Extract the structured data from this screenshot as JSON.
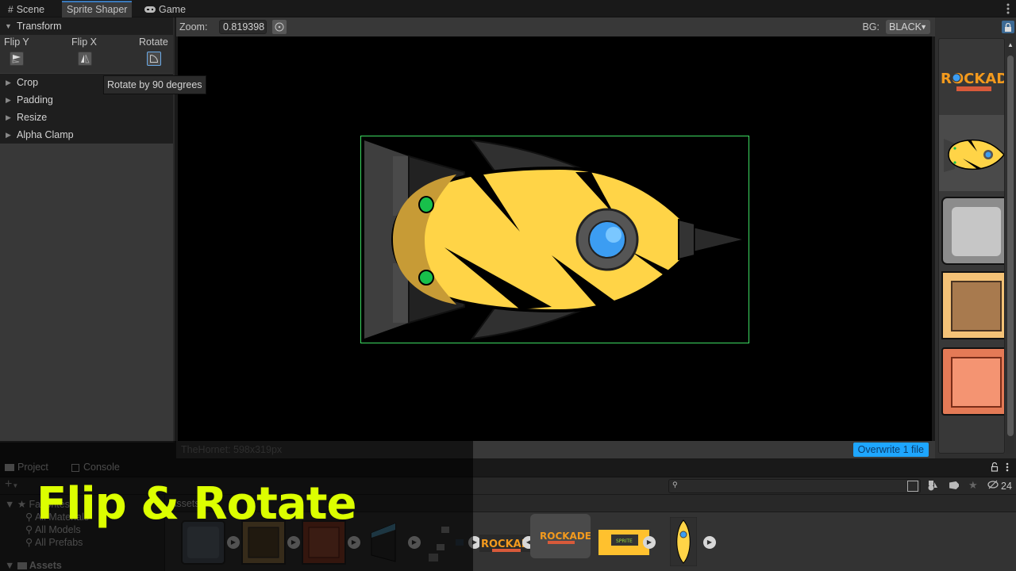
{
  "window": {
    "tabs": [
      {
        "label": "Scene",
        "icon": "grid-icon",
        "active": false
      },
      {
        "label": "Sprite Shaper",
        "active": true
      },
      {
        "label": "Game",
        "icon": "gamepad-icon",
        "active": false
      }
    ]
  },
  "left_panel": {
    "transform": {
      "title": "Transform",
      "expanded": true,
      "tools": [
        {
          "label": "Flip Y",
          "icon": "flip-y-icon"
        },
        {
          "label": "Flip X",
          "icon": "flip-x-icon"
        },
        {
          "label": "Rotate",
          "icon": "rotate-icon",
          "active": true
        }
      ]
    },
    "foldouts": [
      "Crop",
      "Padding",
      "Resize",
      "Alpha Clamp"
    ]
  },
  "tooltip": "Rotate by 90 degrees",
  "viewer": {
    "zoom_label": "Zoom:",
    "zoom_value": "0.819398",
    "bg_label": "BG:",
    "bg_value": "BLACK",
    "accent_border": "#3ddc62"
  },
  "status": {
    "sprite_info": "TheHornet: 598x319px",
    "overwrite_label": "Overwrite 1 file",
    "overwrite_color": "#1ea6ff"
  },
  "thumbnails": [
    {
      "name": "Rockade logo",
      "selected": false
    },
    {
      "name": "TheHornet",
      "selected": true
    },
    {
      "name": "Metal panel",
      "selected": false
    },
    {
      "name": "Wood crate",
      "selected": false
    },
    {
      "name": "Red wood crate",
      "selected": false
    }
  ],
  "project": {
    "tabs": [
      {
        "label": "Project",
        "icon": "folder-icon"
      },
      {
        "label": "Console",
        "icon": "console-icon"
      }
    ],
    "add_label": "+",
    "tree": {
      "favorites_label": "Favorites",
      "favorites": [
        "All Materials",
        "All Models",
        "All Prefabs"
      ],
      "assets_label": "Assets"
    },
    "breadcrumb": "Assets",
    "hidden_count": "24",
    "assets": [
      {
        "name": "metal panel"
      },
      {
        "name": "wood crate"
      },
      {
        "name": "red crate"
      },
      {
        "name": "ground edge"
      },
      {
        "name": "tile sheet"
      },
      {
        "name": "rockade logo"
      },
      {
        "name": "rockade logo selected"
      },
      {
        "name": "sprite shaper banner"
      },
      {
        "name": "the hornet"
      }
    ]
  },
  "overlay_title": "Flip & Rotate",
  "overlay_color": "#dcff00"
}
